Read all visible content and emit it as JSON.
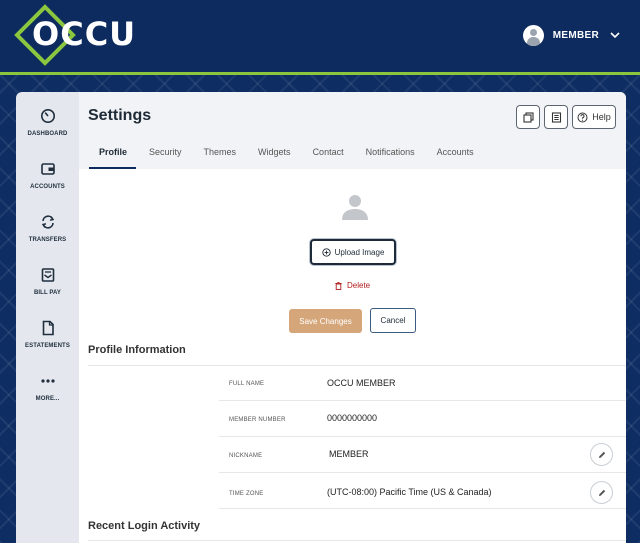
{
  "brand": {
    "name": "OCCU",
    "accent": "#8cc63f",
    "navy": "#0d2b5e"
  },
  "header": {
    "user_name": "MEMBER",
    "avatar_icon": "user-icon",
    "menu_icon": "chevron-down-icon"
  },
  "sidenav": {
    "items": [
      {
        "label": "DASHBOARD",
        "icon": "dashboard-gauge-icon"
      },
      {
        "label": "ACCOUNTS",
        "icon": "wallet-icon"
      },
      {
        "label": "TRANSFERS",
        "icon": "transfer-arrows-icon"
      },
      {
        "label": "BILL PAY",
        "icon": "bill-icon"
      },
      {
        "label": "ESTATEMENTS",
        "icon": "document-icon"
      },
      {
        "label": "MORE...",
        "icon": "more-dots-icon"
      }
    ]
  },
  "page": {
    "title": "Settings",
    "help_label": "Help",
    "tabs": [
      "Profile",
      "Security",
      "Themes",
      "Widgets",
      "Contact",
      "Notifications",
      "Accounts"
    ],
    "active_tab": "Profile"
  },
  "photo": {
    "upload_label": "Upload Image",
    "delete_label": "Delete"
  },
  "actions": {
    "save_label": "Save Changes",
    "cancel_label": "Cancel"
  },
  "profile_info": {
    "title": "Profile Information",
    "rows": [
      {
        "label": "FULL NAME",
        "value": "OCCU  MEMBER",
        "editable": false
      },
      {
        "label": "MEMBER NUMBER",
        "value": "0000000000",
        "editable": false
      },
      {
        "label": "NICKNAME",
        "value": "MEMBER",
        "editable": true
      },
      {
        "label": "TIME ZONE",
        "value": "(UTC-08:00) Pacific Time (US & Canada)",
        "editable": true
      }
    ]
  },
  "recent_login": {
    "title": "Recent Login Activity"
  }
}
